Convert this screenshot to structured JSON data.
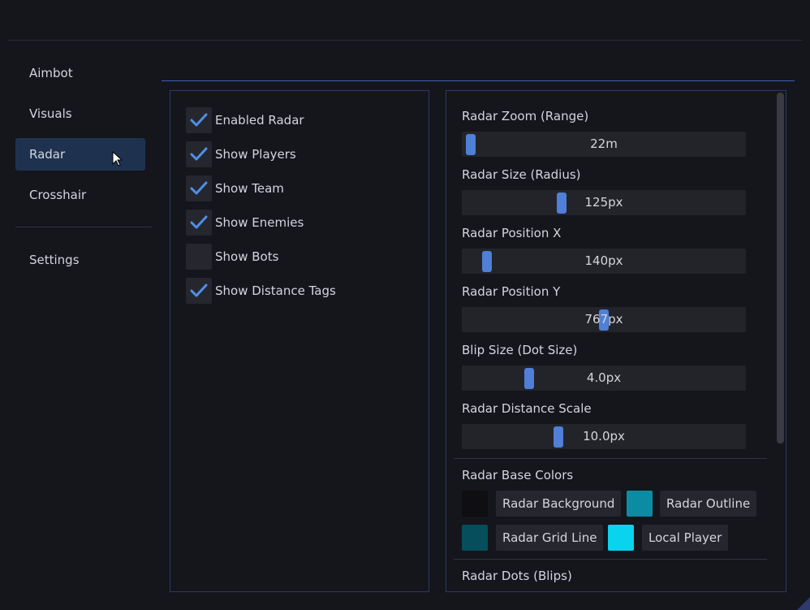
{
  "sidebar": {
    "items": [
      {
        "label": "Aimbot"
      },
      {
        "label": "Visuals"
      },
      {
        "label": "Radar"
      },
      {
        "label": "Crosshair"
      }
    ],
    "settings_label": "Settings"
  },
  "radar_toggles": [
    {
      "label": "Enabled Radar",
      "checked": true
    },
    {
      "label": "Show Players",
      "checked": true
    },
    {
      "label": "Show Team",
      "checked": true
    },
    {
      "label": "Show Enemies",
      "checked": true
    },
    {
      "label": "Show Bots",
      "checked": false
    },
    {
      "label": "Show Distance Tags",
      "checked": true
    }
  ],
  "sliders": [
    {
      "label": "Radar Zoom (Range)",
      "value_text": "22m",
      "fraction": 0.0
    },
    {
      "label": "Radar Size (Radius)",
      "value_text": "125px",
      "fraction": 0.34
    },
    {
      "label": "Radar Position X",
      "value_text": "140px",
      "fraction": 0.06
    },
    {
      "label": "Radar Position Y",
      "value_text": "767px",
      "fraction": 0.5
    },
    {
      "label": "Blip Size (Dot Size)",
      "value_text": "4.0px",
      "fraction": 0.22
    },
    {
      "label": "Radar Distance Scale",
      "value_text": "10.0px",
      "fraction": 0.33
    }
  ],
  "base_colors": {
    "title": "Radar Base Colors",
    "items": [
      {
        "label": "Radar Background",
        "color": "#0f0f11"
      },
      {
        "label": "Radar Outline",
        "color": "#0b8ca3"
      },
      {
        "label": "Radar Grid Line",
        "color": "#064e5c"
      },
      {
        "label": "Local Player",
        "color": "#0ad3ee"
      }
    ]
  },
  "dots_title": "Radar Dots (Blips)",
  "colors": {
    "accent": "#4f7fd6",
    "active_nav": "#1e3250",
    "check": "#4f8fe8"
  }
}
